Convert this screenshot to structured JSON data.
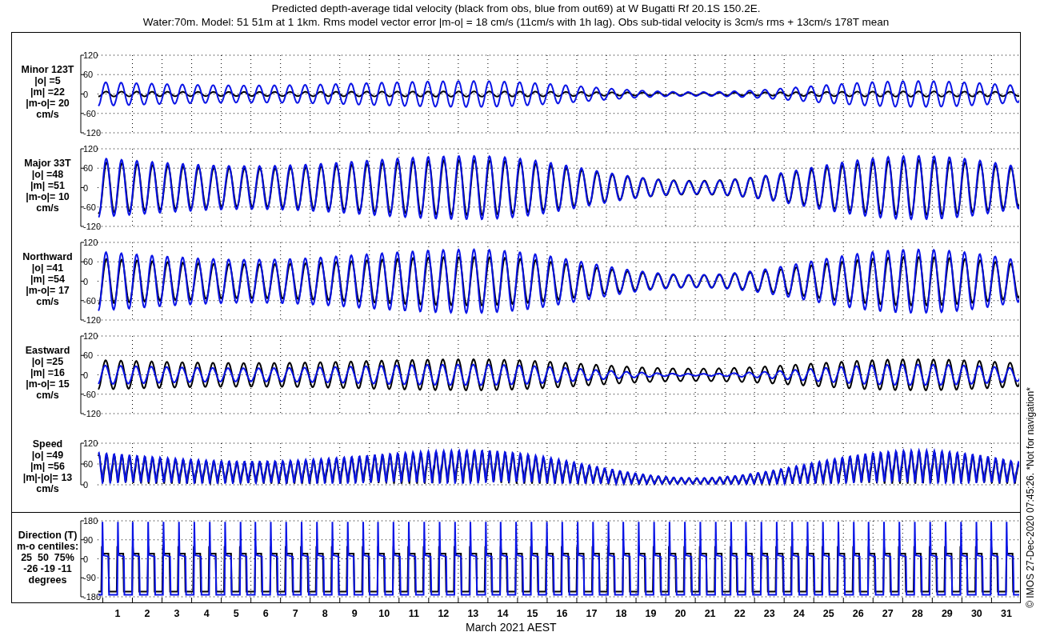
{
  "title": {
    "line_1": "Predicted depth-average tidal velocity (black from obs, blue from out69) at W Bugatti Rf 20.1S 150.2E.",
    "line_2": "Water:70m. Model: 51 51m at 1 1km. Rms model vector error |m-o| = 18 cm/s (11cm/s with 1h lag). Obs sub-tidal velocity is 3cm/s rms + 13cm/s 178T mean"
  },
  "panels": [
    {
      "kind": "velocity",
      "label": [
        "Minor 123T",
        "|o| =5",
        "|m| =22",
        "|m-o|= 20",
        "cm/s"
      ],
      "yticks": [
        "120",
        "60",
        "0",
        "-60",
        "-120"
      ]
    },
    {
      "kind": "velocity",
      "label": [
        "Major 33T",
        "|o| =48",
        "|m| =51",
        "|m-o|= 10",
        "cm/s"
      ],
      "yticks": [
        "120",
        "60",
        "0",
        "-60",
        "-120"
      ]
    },
    {
      "kind": "velocity",
      "label": [
        "Northward",
        "|o| =41",
        "|m| =54",
        "|m-o|= 17",
        "cm/s"
      ],
      "yticks": [
        "120",
        "60",
        "0",
        "-60",
        "-120"
      ]
    },
    {
      "kind": "velocity",
      "label": [
        "Eastward",
        "|o| =25",
        "|m| =16",
        "|m-o|= 15",
        "cm/s"
      ],
      "yticks": [
        "120",
        "60",
        "0",
        "-60",
        "-120"
      ]
    },
    {
      "kind": "speed",
      "label": [
        "Speed",
        "|o| =49",
        "|m| =56",
        "|m|-|o|= 13",
        "cm/s"
      ],
      "yticks": [
        "120",
        "60",
        "0"
      ]
    },
    {
      "kind": "direction",
      "label": [
        "Direction (T)",
        "m-o centiles:",
        "25  50  75%",
        "-26 -19 -11",
        "degrees"
      ],
      "yticks": [
        "180",
        "90",
        "0",
        "-90",
        "-180"
      ]
    }
  ],
  "x_axis": {
    "days": [
      "1",
      "2",
      "3",
      "4",
      "5",
      "6",
      "7",
      "8",
      "9",
      "10",
      "11",
      "12",
      "13",
      "14",
      "15",
      "16",
      "17",
      "18",
      "19",
      "20",
      "21",
      "22",
      "23",
      "24",
      "25",
      "26",
      "27",
      "28",
      "29",
      "30",
      "31"
    ],
    "label": "March 2021 AEST"
  },
  "credit": "© IMOS 27-Dec-2020 07:45:26.  *Not for navigation*"
}
